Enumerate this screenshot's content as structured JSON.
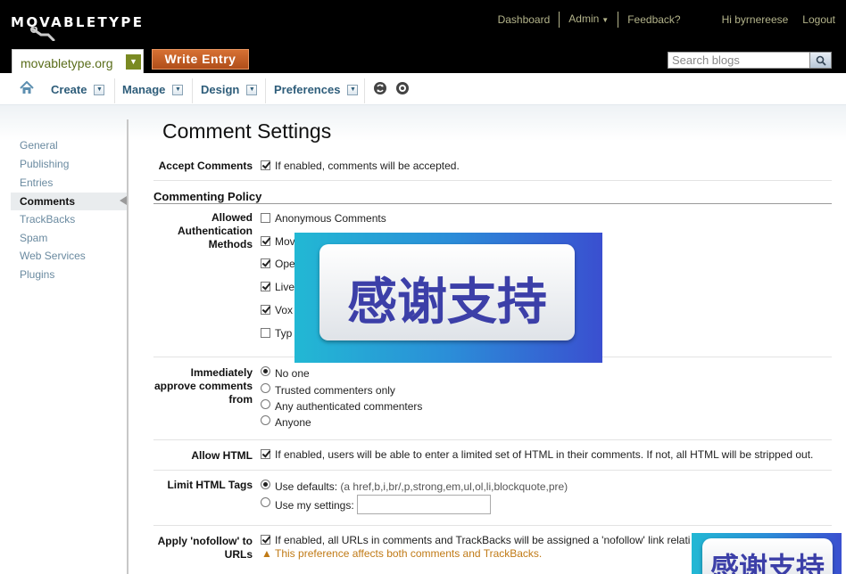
{
  "header": {
    "logo": "MOVABLETYPE",
    "links": {
      "dashboard": "Dashboard",
      "admin": "Admin",
      "feedback": "Feedback?",
      "greeting": "Hi byrnereese",
      "logout": "Logout"
    },
    "blog_name": "movabletype.org",
    "write_entry": "Write Entry",
    "search_placeholder": "Search blogs"
  },
  "nav": {
    "create": "Create",
    "manage": "Manage",
    "design": "Design",
    "preferences": "Preferences"
  },
  "sidebar": {
    "items": [
      "General",
      "Publishing",
      "Entries",
      "Comments",
      "TrackBacks",
      "Spam",
      "Web Services",
      "Plugins"
    ],
    "active": "Comments"
  },
  "main": {
    "title": "Comment Settings",
    "accept_label": "Accept Comments",
    "accept_text": "If enabled, comments will be accepted.",
    "policy_heading": "Commenting Policy",
    "auth_label": "Allowed Authentication Methods",
    "auth_methods": [
      "Anonymous Comments",
      "Mov",
      "Ope",
      "Live",
      "Vox",
      "Typ"
    ],
    "approve_label": "Immediately approve comments from",
    "approve_options": [
      "No one",
      "Trusted commenters only",
      "Any authenticated commenters",
      "Anyone"
    ],
    "html_label": "Allow HTML",
    "html_text": "If enabled, users will be able to enter a limited set of HTML in their comments. If not, all HTML will be stripped out.",
    "limit_label": "Limit HTML Tags",
    "limit_default": "Use defaults:",
    "limit_default_tags": "(a href,b,i,br/,p,strong,em,ul,ol,li,blockquote,pre)",
    "limit_custom": "Use my settings:",
    "nofollow_label": "Apply 'nofollow' to URLs",
    "nofollow_text": "If enabled, all URLs in comments and TrackBacks will be assigned a 'nofollow' link relati",
    "nofollow_warning": "This preference affects both comments and TrackBacks."
  },
  "overlay": {
    "banner_text": "感谢支持"
  }
}
